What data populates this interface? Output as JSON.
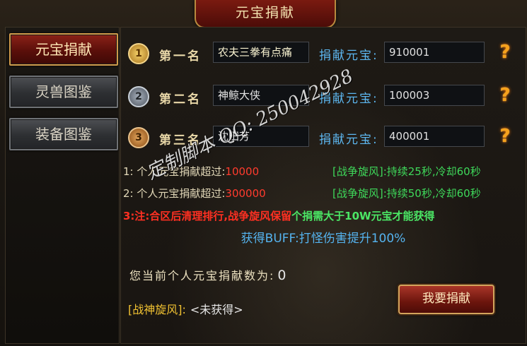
{
  "window": {
    "title": "元宝捐献"
  },
  "sidebar": {
    "items": [
      {
        "label": "元宝捐献",
        "active": true
      },
      {
        "label": "灵兽图鉴",
        "active": false
      },
      {
        "label": "装备图鉴",
        "active": false
      }
    ]
  },
  "rankings": [
    {
      "medal": "1",
      "rank_label": "第一名",
      "name": "农夫三拳有点痛",
      "donate_label": "捐献元宝:",
      "value": "910001"
    },
    {
      "medal": "2",
      "rank_label": "第二名",
      "name": "神鲸大侠",
      "donate_label": "捐献元宝:",
      "value": "100003"
    },
    {
      "medal": "3",
      "rank_label": "第三名",
      "name": "沈田芳",
      "donate_label": "捐献元宝:",
      "value": "400001"
    }
  ],
  "rules": [
    {
      "text": "1: 个人元宝捐献超过:",
      "value": "10000",
      "buff": "[战争旋风]:持续25秒,冷却60秒"
    },
    {
      "text": "2: 个人元宝捐献超过:",
      "value": "300000",
      "buff": "[战争旋风]:持续50秒,冷却60秒"
    }
  ],
  "note": {
    "red": "3:注:合区后清理排行,战争旋风保留",
    "green": "个捐需大于10W元宝才能获得"
  },
  "buff_text": "获得BUFF:打怪伤害提升100%",
  "current": {
    "label": "您当前个人元宝捐献数为:",
    "value": "0"
  },
  "status": {
    "key": "[战神旋风]:",
    "value": "<未获得>"
  },
  "donate_button": "我要捐献",
  "help_icon_glyph": "?",
  "watermark": "定制脚本 QQ: 250042928",
  "colors": {
    "accent_red": "#8c2218",
    "gold": "#d09a4a",
    "blue_label": "#5db7f0",
    "green": "#3ed85a"
  }
}
